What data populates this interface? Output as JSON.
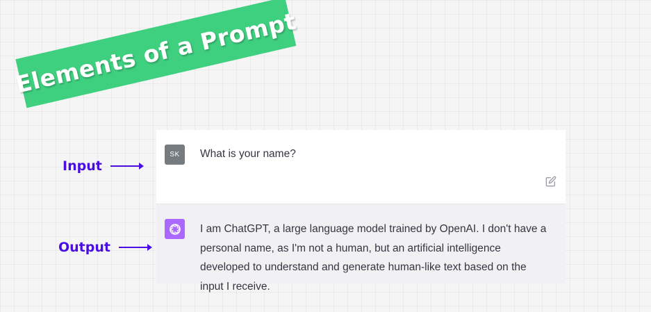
{
  "banner": {
    "title": "Elements of a Prompt"
  },
  "labels": {
    "input": "Input",
    "output": "Output"
  },
  "chat": {
    "user": {
      "avatar_initials": "SK",
      "message": "What is your name?"
    },
    "assistant": {
      "avatar_icon": "openai-logo-icon",
      "message": "I am ChatGPT, a large language model trained by OpenAI. I don't have a personal name, as I'm not a human, but an artificial intelligence developed to understand and generate human-like text based on the input I receive."
    }
  },
  "icons": {
    "edit": "edit-icon"
  },
  "colors": {
    "banner_green": "#3ecf7f",
    "label_purple": "#4a0fe0",
    "user_avatar": "#767b80",
    "bot_avatar": "#ab68ff"
  }
}
